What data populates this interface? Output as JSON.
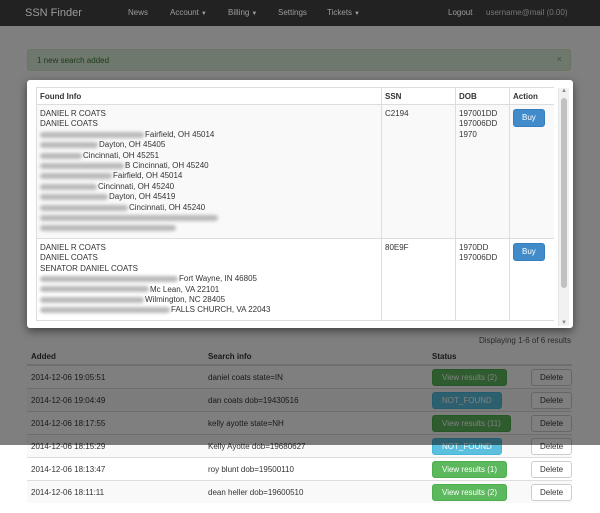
{
  "navbar": {
    "brand": "SSN Finder",
    "items": [
      {
        "label": "News"
      },
      {
        "label": "Account"
      },
      {
        "label": "Billing"
      },
      {
        "label": "Settings"
      },
      {
        "label": "Tickets"
      }
    ],
    "logout": "Logout",
    "user": "username@mail (0.00)"
  },
  "alert": {
    "text": "1 new search added",
    "close": "×"
  },
  "modal": {
    "headers": {
      "found_info": "Found Info",
      "ssn": "SSN",
      "dob": "DOB",
      "action": "Action"
    },
    "rows": [
      {
        "names": [
          "DANIEL R COATS",
          "DANIEL COATS"
        ],
        "addresses": [
          "Fairfield, OH 45014",
          "Dayton, OH 45405",
          "Cincinnati, OH 45251",
          "B Cincinnati, OH 45240",
          "Fairfield, OH 45014",
          "Cincinnati, OH 45240",
          "Dayton, OH 45419",
          "Cincinnati, OH 45240"
        ],
        "ssn": "C2194",
        "dob": [
          "197001DD",
          "197006DD",
          "1970"
        ],
        "action": "Buy"
      },
      {
        "names": [
          "DANIEL R COATS",
          "DANIEL COATS",
          "SENATOR DANIEL COATS"
        ],
        "addresses": [
          "Fort Wayne, IN 46805",
          "Mc Lean, VA 22101",
          "Wilmington, NC 28405",
          "FALLS CHURCH, VA 22043"
        ],
        "ssn": "80E9F",
        "dob": [
          "1970DD",
          "197006DD"
        ],
        "action": "Buy"
      }
    ]
  },
  "displaying": "Displaying 1-6 of 6 results",
  "table": {
    "headers": {
      "added": "Added",
      "search_info": "Search info",
      "status": "Status"
    },
    "rows": [
      {
        "added": "2014-12-06 19:05:51",
        "info": "daniel coats state=IN",
        "status": "View results (2)",
        "type": "success",
        "delete": "Delete"
      },
      {
        "added": "2014-12-06 19:04:49",
        "info": "dan coats dob=19430516",
        "status": "NOT_FOUND",
        "type": "info",
        "delete": "Delete"
      },
      {
        "added": "2014-12-06 18:17:55",
        "info": "kelly ayotte state=NH",
        "status": "View results (11)",
        "type": "success",
        "delete": "Delete"
      },
      {
        "added": "2014-12-06 18:15:29",
        "info": "Kelly Ayotte dob=19680627",
        "status": "NOT_FOUND",
        "type": "info",
        "delete": "Delete"
      },
      {
        "added": "2014-12-06 18:13:47",
        "info": "roy blunt dob=19500110",
        "status": "View results (1)",
        "type": "success",
        "delete": "Delete"
      },
      {
        "added": "2014-12-06 18:11:11",
        "info": "dean heller dob=19600510",
        "status": "View results (2)",
        "type": "success",
        "delete": "Delete"
      }
    ]
  },
  "colors": {
    "success": "#5cb85c",
    "info": "#5bc0de",
    "primary": "#428bca",
    "navbar": "#222222"
  }
}
